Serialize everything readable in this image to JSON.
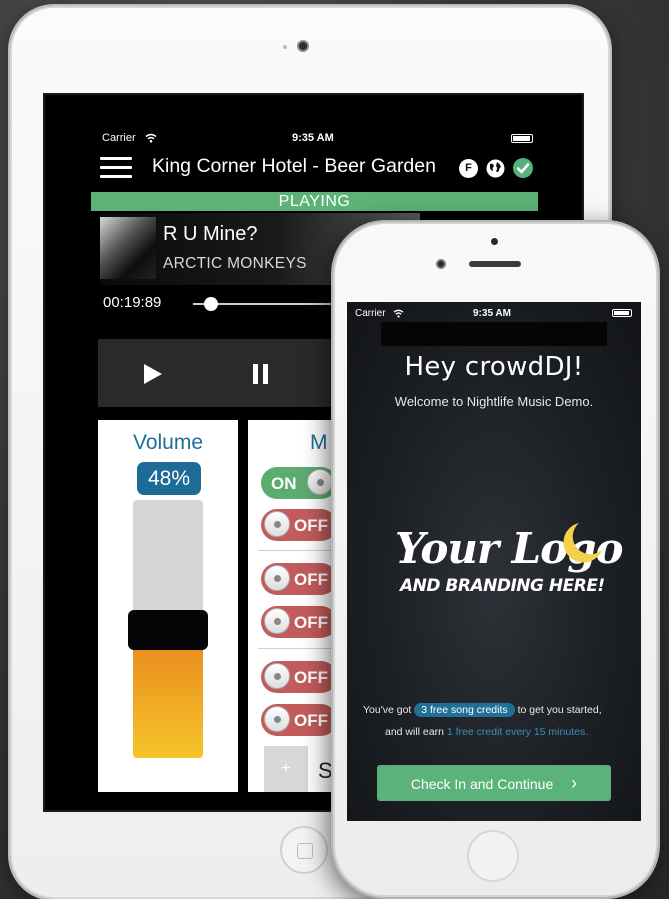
{
  "ipad": {
    "status": {
      "carrier": "Carrier",
      "time": "9:35 AM"
    },
    "header": {
      "venue": "King Corner Hotel -  Beer Garden",
      "badges": {
        "f": "F",
        "globe_icon": "globe-icon",
        "check_icon": "check-icon"
      }
    },
    "playing_label": "PLAYING",
    "track": {
      "title": "R U Mine?",
      "artist": "ARCTIC MONKEYS",
      "elapsed": "00:19:89",
      "progress": 0.08
    },
    "controls": {
      "play_icon": "play-icon",
      "pause_icon": "pause-icon"
    },
    "volume": {
      "title": "Volume",
      "value_label": "48%",
      "level": 0.48
    },
    "music_panel": {
      "title_partial": "M",
      "toggles": [
        "ON",
        "OFF",
        "OFF",
        "OFF",
        "OFF",
        "OFF"
      ],
      "add_symbol": "+",
      "label_partial": "S"
    },
    "colors": {
      "playing": "#5cb277",
      "accent_blue": "#1d6b96",
      "on": "#5cab6f",
      "off": "#c25c5c",
      "volume_fill": "#f0a623"
    }
  },
  "iphone": {
    "status": {
      "carrier": "Carrier",
      "time": "9:35 AM"
    },
    "greeting": "Hey crowdDJ!",
    "welcome": "Welcome to Nightlife Music Demo.",
    "logo": {
      "line1": "Your Logo",
      "line2": "AND BRANDING HERE!",
      "moon_icon": "moon-icon"
    },
    "credits": {
      "prefix": "You've got",
      "pill": "3 free song credits",
      "suffix": "to get you started,",
      "line2_prefix": "and will earn",
      "line2_link": "1 free credit every 15 minutes."
    },
    "cta": {
      "label": "Check In and Continue",
      "chevron": "›"
    }
  }
}
